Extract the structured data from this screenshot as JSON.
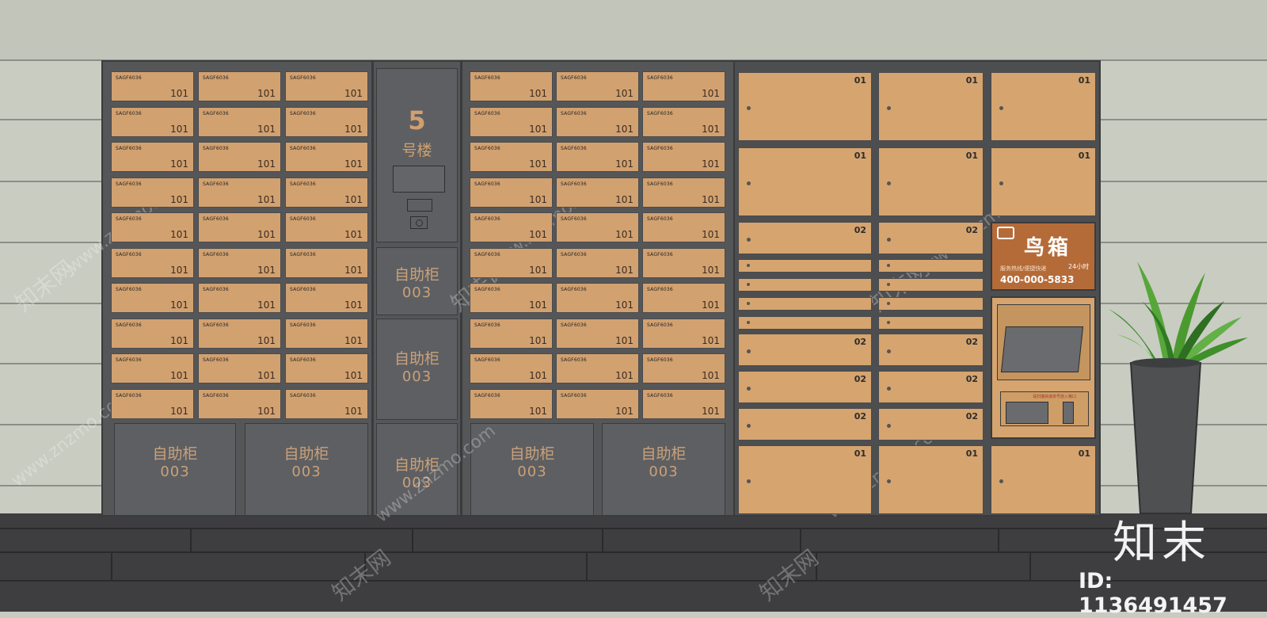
{
  "building": {
    "number": "5",
    "label": "号楼"
  },
  "mailbox": {
    "brand": "SAGF6036",
    "number": "101"
  },
  "self_service": {
    "title": "自助柜",
    "code": "003"
  },
  "locker_numbers": {
    "large": "01",
    "small": "02"
  },
  "ad": {
    "brand": "鸟箱",
    "tagline": "服务热线/便捷快递",
    "hours": "24小时",
    "phone": "400-000-5833"
  },
  "kiosk": {
    "note": "请扫描快递单号放入格口"
  },
  "watermark": {
    "site_cn": "知末网",
    "site_url": "www.znzmo.com",
    "logo": "知末",
    "id_text": "ID: 1136491457"
  }
}
